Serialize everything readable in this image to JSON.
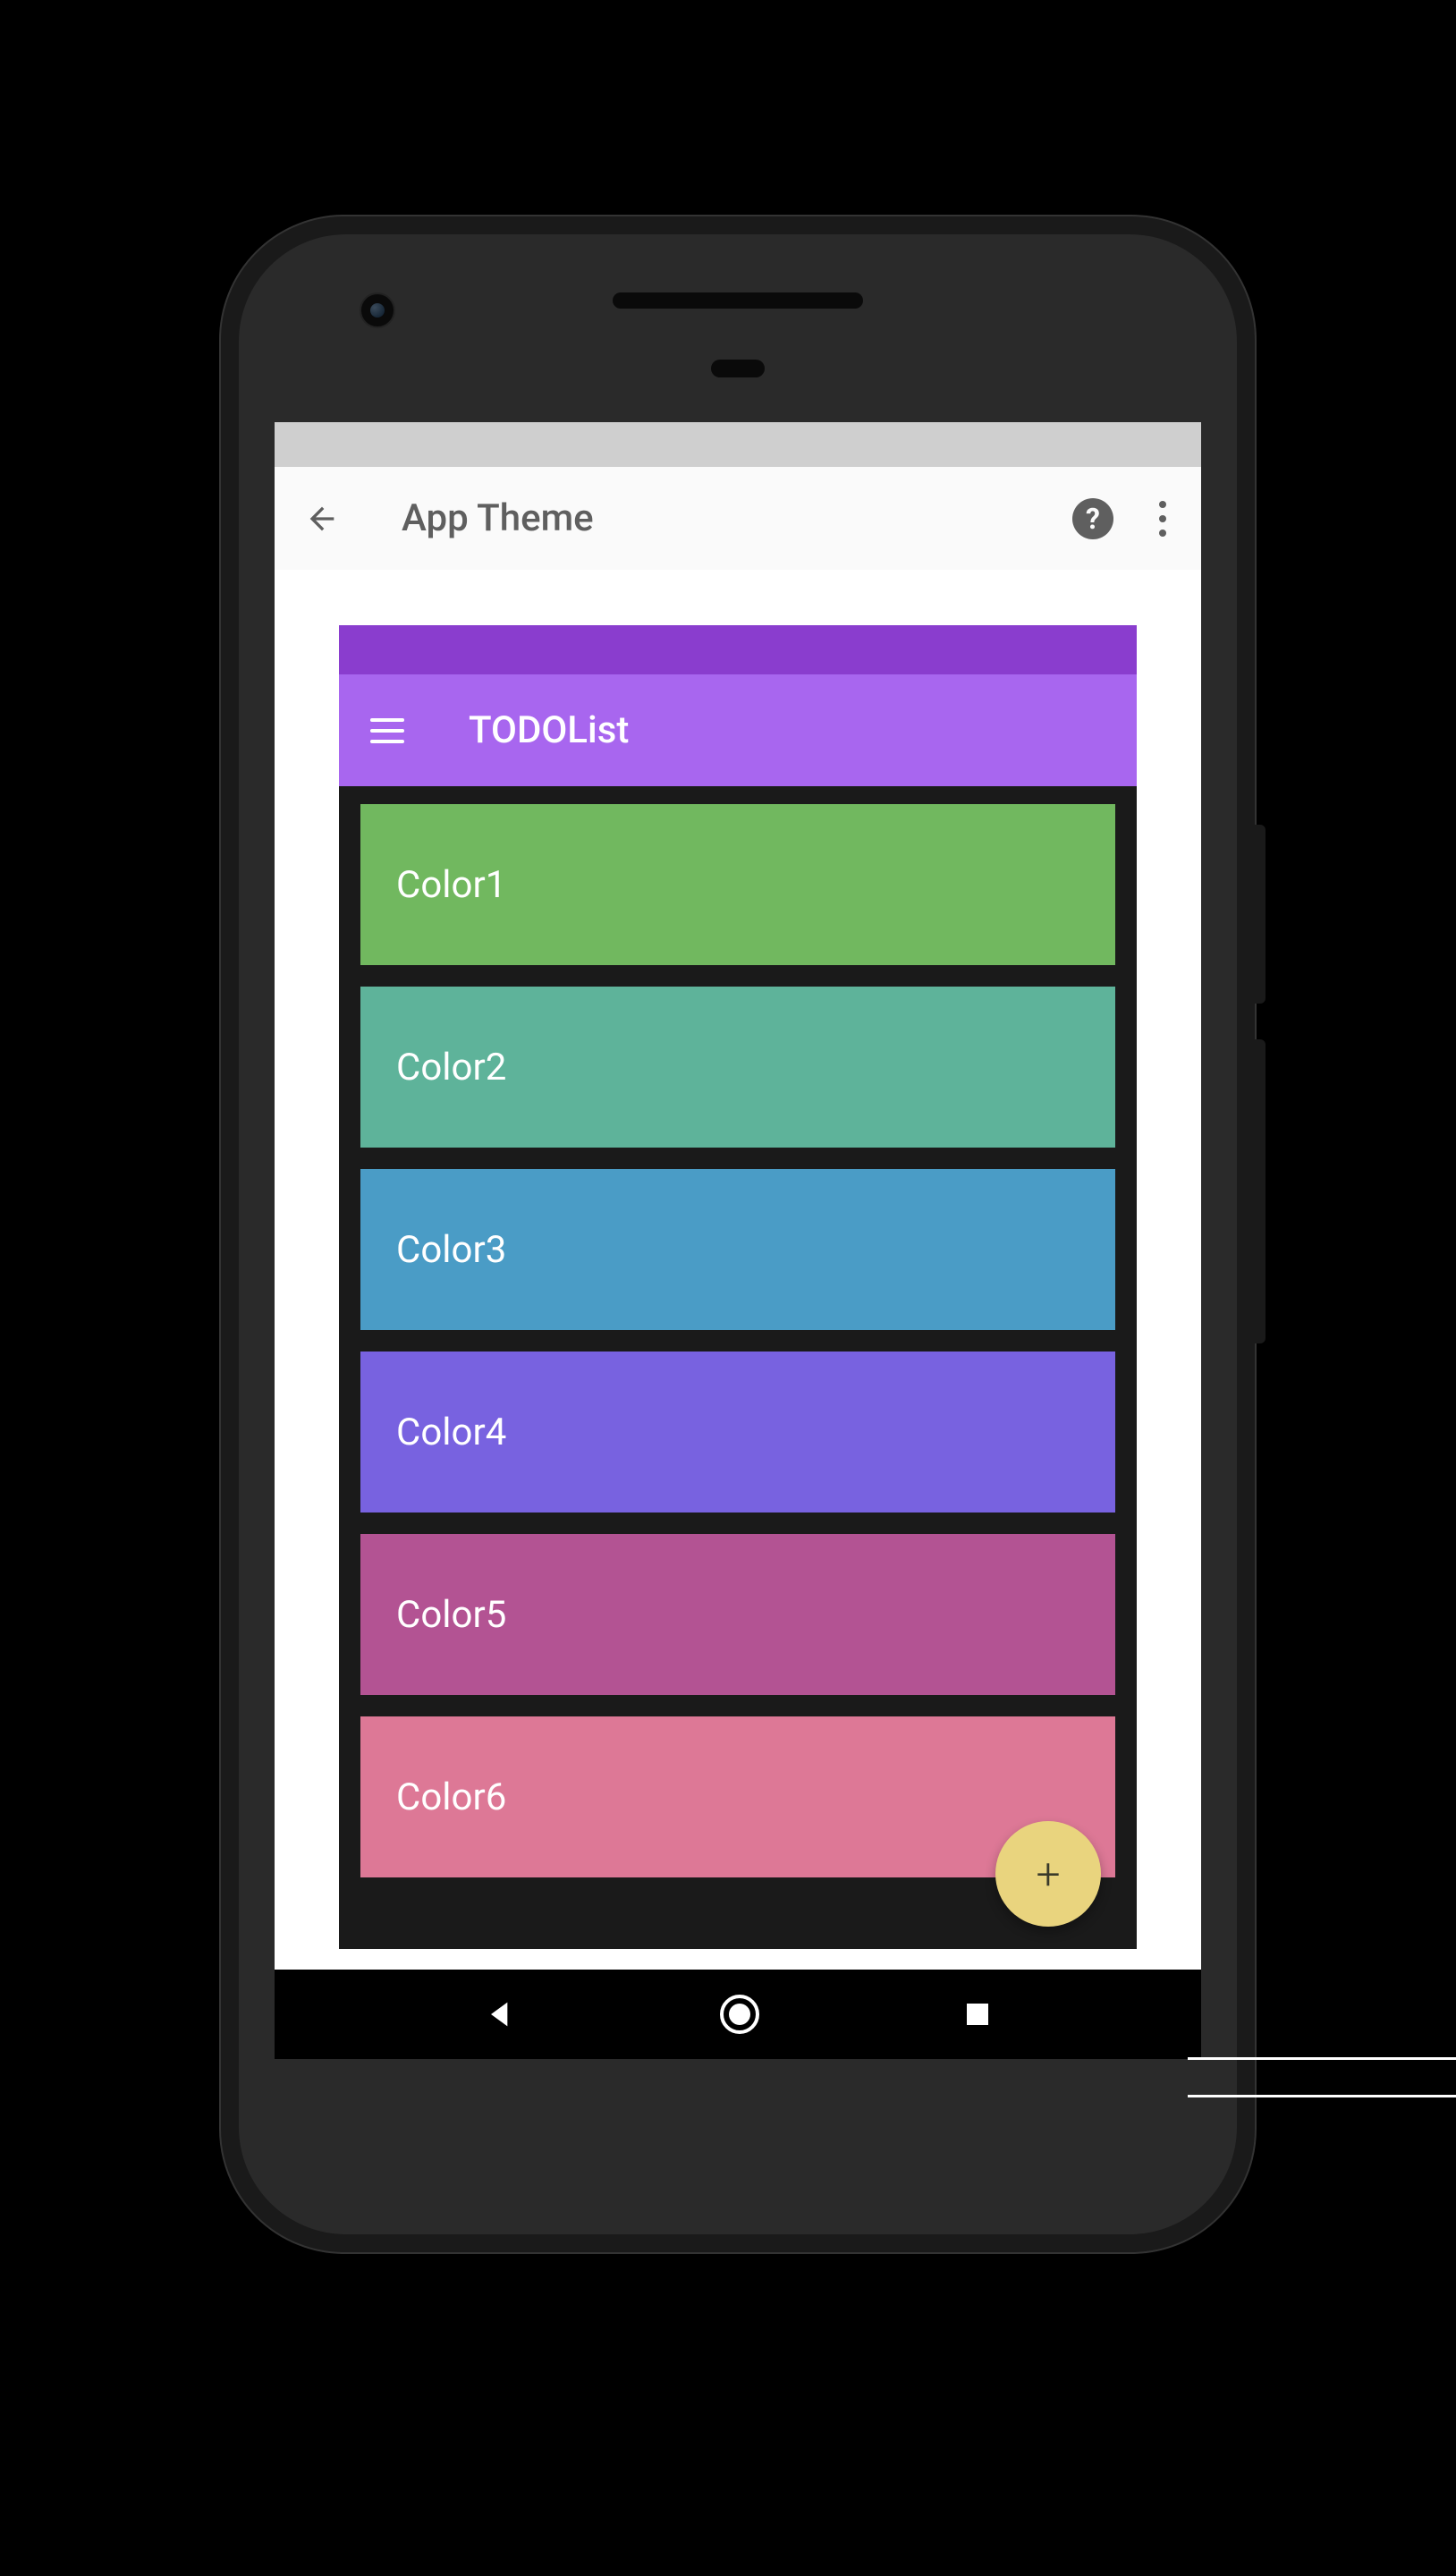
{
  "app_bar": {
    "title": "App Theme"
  },
  "preview": {
    "app_title": "TODOList",
    "items": [
      {
        "label": "Color1",
        "color": "#71b85f"
      },
      {
        "label": "Color2",
        "color": "#5eb39a"
      },
      {
        "label": "Color3",
        "color": "#4a9cc6"
      },
      {
        "label": "Color4",
        "color": "#7862e0"
      },
      {
        "label": "Color5",
        "color": "#b35393"
      },
      {
        "label": "Color6",
        "color": "#dd7896"
      }
    ]
  },
  "fab_icon": "+",
  "help_icon": "?"
}
